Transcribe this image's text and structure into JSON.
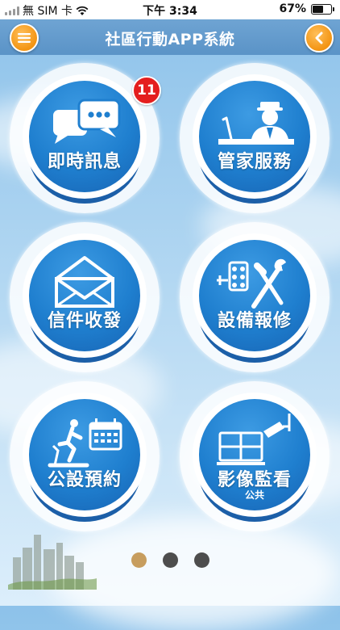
{
  "status_bar": {
    "carrier": "無 SIM 卡",
    "time": "下午 3:34",
    "battery": "67%",
    "battery_level": 0.67
  },
  "header": {
    "title": "社區行動APP系統"
  },
  "tiles": [
    {
      "label": "即時訊息",
      "badge": "11",
      "icon": "chat-bubbles-icon"
    },
    {
      "label": "管家服務",
      "icon": "concierge-icon"
    },
    {
      "label": "信件收發",
      "icon": "envelope-icon"
    },
    {
      "label": "設備報修",
      "icon": "repair-tools-icon"
    },
    {
      "label": "公設預約",
      "icon": "treadmill-calendar-icon"
    },
    {
      "label": "影像監看",
      "sublabel": "公共",
      "icon": "cctv-monitor-icon"
    }
  ],
  "pagination": {
    "pages": 3,
    "current": 1
  },
  "colors": {
    "accent_orange": "#f39412",
    "tile_blue": "#1f7fcf",
    "badge_red": "#e41e1e",
    "active_dot": "#c79d5e"
  }
}
